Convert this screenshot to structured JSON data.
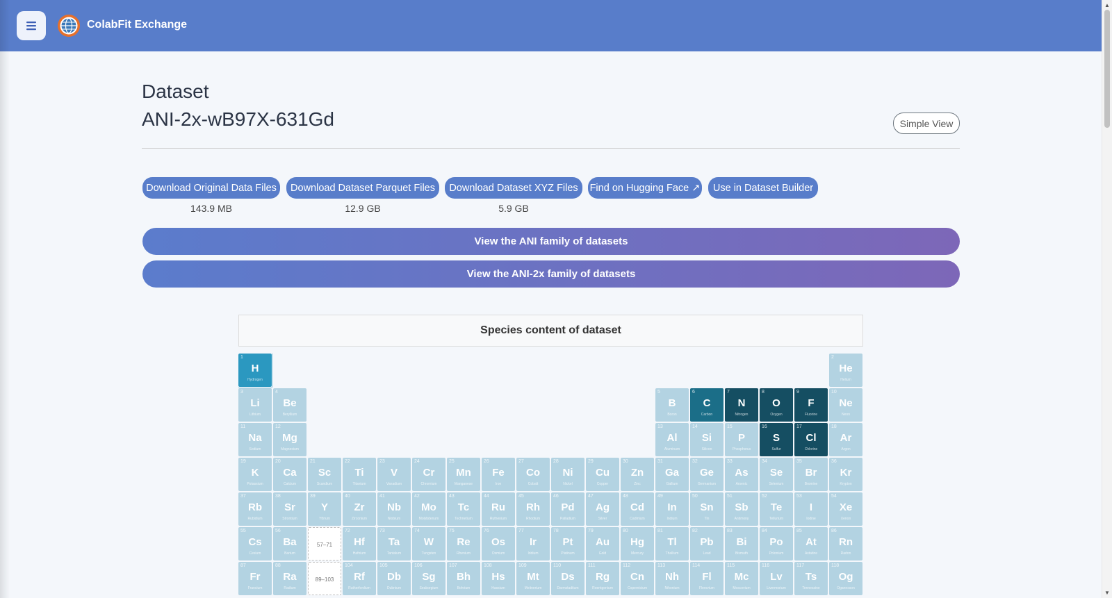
{
  "app": {
    "title": "ColabFit Exchange"
  },
  "header": {
    "eyebrow": "Dataset",
    "dataset_name": "ANI-2x-wB97X-631Gd",
    "simple_view_label": "Simple View"
  },
  "downloads": [
    {
      "label": "Download Original Data Files",
      "size": "143.9 MB"
    },
    {
      "label": "Download Dataset Parquet Files",
      "size": "12.9 GB"
    },
    {
      "label": "Download Dataset XYZ Files",
      "size": "5.9 GB"
    },
    {
      "label": "Find on Hugging Face ↗",
      "size": ""
    },
    {
      "label": "Use in Dataset Builder",
      "size": ""
    }
  ],
  "families": [
    {
      "label": "View the ANI family of datasets"
    },
    {
      "label": "View the ANI-2x family of datasets"
    }
  ],
  "species": {
    "title": "Species content of dataset",
    "present": [
      "H",
      "C",
      "N",
      "O",
      "F",
      "S",
      "Cl"
    ],
    "placeholders": [
      "57–71",
      "89–103"
    ],
    "elements": [
      {
        "n": 1,
        "s": "H",
        "name": "Hydrogen",
        "r": 1,
        "c": 1
      },
      {
        "n": 2,
        "s": "He",
        "name": "Helium",
        "r": 1,
        "c": 18
      },
      {
        "n": 3,
        "s": "Li",
        "name": "Lithium",
        "r": 2,
        "c": 1
      },
      {
        "n": 4,
        "s": "Be",
        "name": "Beryllium",
        "r": 2,
        "c": 2
      },
      {
        "n": 5,
        "s": "B",
        "name": "Boron",
        "r": 2,
        "c": 13
      },
      {
        "n": 6,
        "s": "C",
        "name": "Carbon",
        "r": 2,
        "c": 14
      },
      {
        "n": 7,
        "s": "N",
        "name": "Nitrogen",
        "r": 2,
        "c": 15
      },
      {
        "n": 8,
        "s": "O",
        "name": "Oxygen",
        "r": 2,
        "c": 16
      },
      {
        "n": 9,
        "s": "F",
        "name": "Fluorine",
        "r": 2,
        "c": 17
      },
      {
        "n": 10,
        "s": "Ne",
        "name": "Neon",
        "r": 2,
        "c": 18
      },
      {
        "n": 11,
        "s": "Na",
        "name": "Sodium",
        "r": 3,
        "c": 1
      },
      {
        "n": 12,
        "s": "Mg",
        "name": "Magnesium",
        "r": 3,
        "c": 2
      },
      {
        "n": 13,
        "s": "Al",
        "name": "Aluminum",
        "r": 3,
        "c": 13
      },
      {
        "n": 14,
        "s": "Si",
        "name": "Silicon",
        "r": 3,
        "c": 14
      },
      {
        "n": 15,
        "s": "P",
        "name": "Phosphorus",
        "r": 3,
        "c": 15
      },
      {
        "n": 16,
        "s": "S",
        "name": "Sulfur",
        "r": 3,
        "c": 16
      },
      {
        "n": 17,
        "s": "Cl",
        "name": "Chlorine",
        "r": 3,
        "c": 17
      },
      {
        "n": 18,
        "s": "Ar",
        "name": "Argon",
        "r": 3,
        "c": 18
      },
      {
        "n": 19,
        "s": "K",
        "name": "Potassium",
        "r": 4,
        "c": 1
      },
      {
        "n": 20,
        "s": "Ca",
        "name": "Calcium",
        "r": 4,
        "c": 2
      },
      {
        "n": 21,
        "s": "Sc",
        "name": "Scandium",
        "r": 4,
        "c": 3
      },
      {
        "n": 22,
        "s": "Ti",
        "name": "Titanium",
        "r": 4,
        "c": 4
      },
      {
        "n": 23,
        "s": "V",
        "name": "Vanadium",
        "r": 4,
        "c": 5
      },
      {
        "n": 24,
        "s": "Cr",
        "name": "Chromium",
        "r": 4,
        "c": 6
      },
      {
        "n": 25,
        "s": "Mn",
        "name": "Manganese",
        "r": 4,
        "c": 7
      },
      {
        "n": 26,
        "s": "Fe",
        "name": "Iron",
        "r": 4,
        "c": 8
      },
      {
        "n": 27,
        "s": "Co",
        "name": "Cobalt",
        "r": 4,
        "c": 9
      },
      {
        "n": 28,
        "s": "Ni",
        "name": "Nickel",
        "r": 4,
        "c": 10
      },
      {
        "n": 29,
        "s": "Cu",
        "name": "Copper",
        "r": 4,
        "c": 11
      },
      {
        "n": 30,
        "s": "Zn",
        "name": "Zinc",
        "r": 4,
        "c": 12
      },
      {
        "n": 31,
        "s": "Ga",
        "name": "Gallium",
        "r": 4,
        "c": 13
      },
      {
        "n": 32,
        "s": "Ge",
        "name": "Germanium",
        "r": 4,
        "c": 14
      },
      {
        "n": 33,
        "s": "As",
        "name": "Arsenic",
        "r": 4,
        "c": 15
      },
      {
        "n": 34,
        "s": "Se",
        "name": "Selenium",
        "r": 4,
        "c": 16
      },
      {
        "n": 35,
        "s": "Br",
        "name": "Bromine",
        "r": 4,
        "c": 17
      },
      {
        "n": 36,
        "s": "Kr",
        "name": "Krypton",
        "r": 4,
        "c": 18
      },
      {
        "n": 37,
        "s": "Rb",
        "name": "Rubidium",
        "r": 5,
        "c": 1
      },
      {
        "n": 38,
        "s": "Sr",
        "name": "Strontium",
        "r": 5,
        "c": 2
      },
      {
        "n": 39,
        "s": "Y",
        "name": "Yttrium",
        "r": 5,
        "c": 3
      },
      {
        "n": 40,
        "s": "Zr",
        "name": "Zirconium",
        "r": 5,
        "c": 4
      },
      {
        "n": 41,
        "s": "Nb",
        "name": "Niobium",
        "r": 5,
        "c": 5
      },
      {
        "n": 42,
        "s": "Mo",
        "name": "Molybdenum",
        "r": 5,
        "c": 6
      },
      {
        "n": 43,
        "s": "Tc",
        "name": "Technetium",
        "r": 5,
        "c": 7
      },
      {
        "n": 44,
        "s": "Ru",
        "name": "Ruthenium",
        "r": 5,
        "c": 8
      },
      {
        "n": 45,
        "s": "Rh",
        "name": "Rhodium",
        "r": 5,
        "c": 9
      },
      {
        "n": 46,
        "s": "Pd",
        "name": "Palladium",
        "r": 5,
        "c": 10
      },
      {
        "n": 47,
        "s": "Ag",
        "name": "Silver",
        "r": 5,
        "c": 11
      },
      {
        "n": 48,
        "s": "Cd",
        "name": "Cadmium",
        "r": 5,
        "c": 12
      },
      {
        "n": 49,
        "s": "In",
        "name": "Indium",
        "r": 5,
        "c": 13
      },
      {
        "n": 50,
        "s": "Sn",
        "name": "Tin",
        "r": 5,
        "c": 14
      },
      {
        "n": 51,
        "s": "Sb",
        "name": "Antimony",
        "r": 5,
        "c": 15
      },
      {
        "n": 52,
        "s": "Te",
        "name": "Tellurium",
        "r": 5,
        "c": 16
      },
      {
        "n": 53,
        "s": "I",
        "name": "Iodine",
        "r": 5,
        "c": 17
      },
      {
        "n": 54,
        "s": "Xe",
        "name": "Xenon",
        "r": 5,
        "c": 18
      },
      {
        "n": 55,
        "s": "Cs",
        "name": "Cesium",
        "r": 6,
        "c": 1
      },
      {
        "n": 56,
        "s": "Ba",
        "name": "Barium",
        "r": 6,
        "c": 2
      },
      {
        "n": 72,
        "s": "Hf",
        "name": "Hafnium",
        "r": 6,
        "c": 4
      },
      {
        "n": 73,
        "s": "Ta",
        "name": "Tantalum",
        "r": 6,
        "c": 5
      },
      {
        "n": 74,
        "s": "W",
        "name": "Tungsten",
        "r": 6,
        "c": 6
      },
      {
        "n": 75,
        "s": "Re",
        "name": "Rhenium",
        "r": 6,
        "c": 7
      },
      {
        "n": 76,
        "s": "Os",
        "name": "Osmium",
        "r": 6,
        "c": 8
      },
      {
        "n": 77,
        "s": "Ir",
        "name": "Iridium",
        "r": 6,
        "c": 9
      },
      {
        "n": 78,
        "s": "Pt",
        "name": "Platinum",
        "r": 6,
        "c": 10
      },
      {
        "n": 79,
        "s": "Au",
        "name": "Gold",
        "r": 6,
        "c": 11
      },
      {
        "n": 80,
        "s": "Hg",
        "name": "Mercury",
        "r": 6,
        "c": 12
      },
      {
        "n": 81,
        "s": "Tl",
        "name": "Thallium",
        "r": 6,
        "c": 13
      },
      {
        "n": 82,
        "s": "Pb",
        "name": "Lead",
        "r": 6,
        "c": 14
      },
      {
        "n": 83,
        "s": "Bi",
        "name": "Bismuth",
        "r": 6,
        "c": 15
      },
      {
        "n": 84,
        "s": "Po",
        "name": "Polonium",
        "r": 6,
        "c": 16
      },
      {
        "n": 85,
        "s": "At",
        "name": "Astatine",
        "r": 6,
        "c": 17
      },
      {
        "n": 86,
        "s": "Rn",
        "name": "Radon",
        "r": 6,
        "c": 18
      },
      {
        "n": 87,
        "s": "Fr",
        "name": "Francium",
        "r": 7,
        "c": 1
      },
      {
        "n": 88,
        "s": "Ra",
        "name": "Radium",
        "r": 7,
        "c": 2
      },
      {
        "n": 104,
        "s": "Rf",
        "name": "Rutherfordium",
        "r": 7,
        "c": 4
      },
      {
        "n": 105,
        "s": "Db",
        "name": "Dubnium",
        "r": 7,
        "c": 5
      },
      {
        "n": 106,
        "s": "Sg",
        "name": "Seaborgium",
        "r": 7,
        "c": 6
      },
      {
        "n": 107,
        "s": "Bh",
        "name": "Bohrium",
        "r": 7,
        "c": 7
      },
      {
        "n": 108,
        "s": "Hs",
        "name": "Hassium",
        "r": 7,
        "c": 8
      },
      {
        "n": 109,
        "s": "Mt",
        "name": "Meitnerium",
        "r": 7,
        "c": 9
      },
      {
        "n": 110,
        "s": "Ds",
        "name": "Darmstadtium",
        "r": 7,
        "c": 10
      },
      {
        "n": 111,
        "s": "Rg",
        "name": "Roentgenium",
        "r": 7,
        "c": 11
      },
      {
        "n": 112,
        "s": "Cn",
        "name": "Copernicium",
        "r": 7,
        "c": 12
      },
      {
        "n": 113,
        "s": "Nh",
        "name": "Nihonium",
        "r": 7,
        "c": 13
      },
      {
        "n": 114,
        "s": "Fl",
        "name": "Flerovium",
        "r": 7,
        "c": 14
      },
      {
        "n": 115,
        "s": "Mc",
        "name": "Moscovium",
        "r": 7,
        "c": 15
      },
      {
        "n": 116,
        "s": "Lv",
        "name": "Livermorium",
        "r": 7,
        "c": 16
      },
      {
        "n": 117,
        "s": "Ts",
        "name": "Tennessine",
        "r": 7,
        "c": 17
      },
      {
        "n": 118,
        "s": "Og",
        "name": "Oganesson",
        "r": 7,
        "c": 18
      }
    ]
  },
  "colors": {
    "header_bg": "#587dca",
    "button_bg": "#587dca",
    "gradient_start": "#5b7ccc",
    "gradient_end": "#7d67b8",
    "element_absent": "#b3d3e2",
    "element_hydrogen": "#2b98c0",
    "element_carbon": "#1b6e88",
    "element_dense": "#154e62"
  }
}
